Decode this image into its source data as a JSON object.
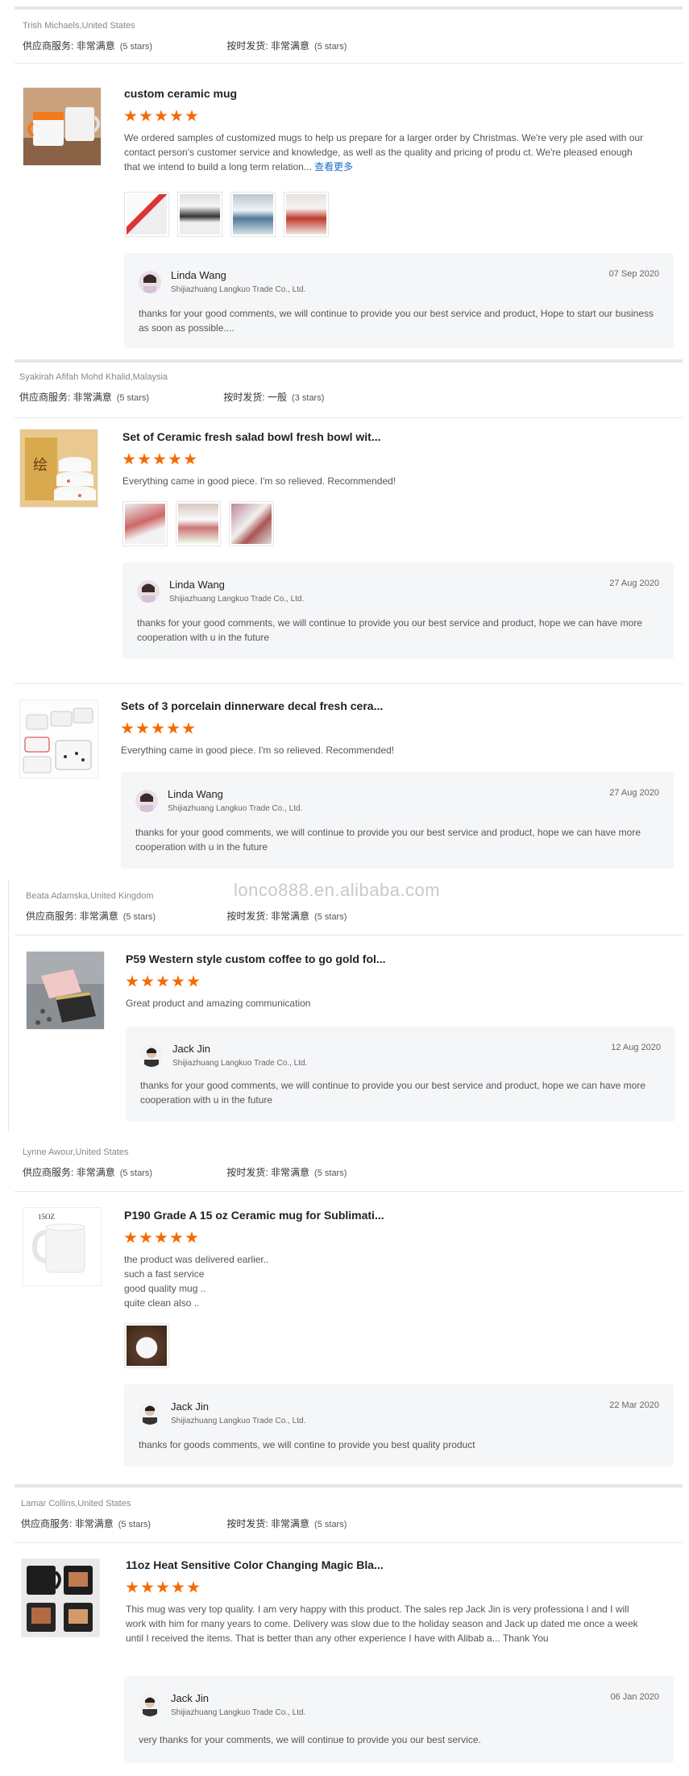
{
  "watermark": "lonco888.en.alibaba.com",
  "labels": {
    "supplier_service": "供应商服务:",
    "on_time": "按时发货:"
  },
  "reviews": [
    {
      "reviewer": "Trish Michaels,United States",
      "supplier_value": "非常满意",
      "supplier_stars": "(5 stars)",
      "ontime_value": "非常满意",
      "ontime_stars": "(5 stars)",
      "items": [
        {
          "title": "custom ceramic mug",
          "rating": 5,
          "text": "We ordered samples of customized mugs to help us prepare for a larger order by Christmas.  We're very ple ased with our contact person's customer service and knowledge, as well as the quality and pricing of produ ct. We're pleased enough that we intend to build a long term relation...",
          "more": "查看更多",
          "reply": {
            "name": "Linda Wang",
            "company": "Shijiazhuang Langkuo Trade Co., Ltd.",
            "date": "07 Sep 2020",
            "text": "thanks for your good comments, we will continue to provide you our best service and product, Hope to start our business as soon as possible...."
          }
        }
      ]
    },
    {
      "reviewer": "Syakirah Afifah Mohd Khalid,Malaysia",
      "supplier_value": "非常满意",
      "supplier_stars": "(5 stars)",
      "ontime_value": "一般",
      "ontime_stars": "(3 stars)",
      "items": [
        {
          "title": "Set of Ceramic fresh salad bowl fresh bowl wit...",
          "rating": 5,
          "text": "Everything came in good piece. I'm so relieved. Recommended!",
          "reply": {
            "name": "Linda Wang",
            "company": "Shijiazhuang Langkuo Trade Co., Ltd.",
            "date": "27 Aug 2020",
            "text": "thanks for your good comments, we will continue to provide you our best service and product, hope we can have more cooperation with u in the future"
          }
        },
        {
          "title": "Sets of 3 porcelain dinnerware decal fresh cera...",
          "rating": 5,
          "text": "Everything came in good piece. I'm so relieved. Recommended!",
          "reply": {
            "name": "Linda Wang",
            "company": "Shijiazhuang Langkuo Trade Co., Ltd.",
            "date": "27 Aug 2020",
            "text": "thanks for your good comments, we will continue to provide you our best service and product, hope we can have more cooperation with u in the future"
          }
        }
      ]
    },
    {
      "reviewer": "Beata Adamska,United Kingdom",
      "supplier_value": "非常满意",
      "supplier_stars": "(5 stars)",
      "ontime_value": "非常满意",
      "ontime_stars": "(5 stars)",
      "items": [
        {
          "title": "P59 Western style custom coffee to go gold fol...",
          "rating": 5,
          "text": "Great product and amazing communication",
          "reply": {
            "name": "Jack Jin",
            "company": "Shijiazhuang Langkuo Trade Co., Ltd.",
            "date": "12 Aug 2020",
            "text": "thanks for your good comments, we will continue to provide you our best service and product, hope we can have more cooperation with u in the future"
          }
        }
      ]
    },
    {
      "reviewer": "Lynne Awour,United States",
      "supplier_value": "非常满意",
      "supplier_stars": "(5 stars)",
      "ontime_value": "非常满意",
      "ontime_stars": "(5 stars)",
      "items": [
        {
          "title": "P190 Grade A 15 oz Ceramic mug for Sublimati...",
          "thumb_label": "15OZ",
          "rating": 5,
          "text_lines": [
            "the product was delivered earlier..",
            "such a fast service",
            "good quality mug ..",
            "quite clean also .."
          ],
          "reply": {
            "name": "Jack Jin",
            "company": "Shijiazhuang Langkuo Trade Co., Ltd.",
            "date": "22 Mar 2020",
            "text": "thanks for goods comments, we will contine to provide you best quality product"
          }
        }
      ]
    },
    {
      "reviewer": "Lamar Collins,United States",
      "supplier_value": "非常满意",
      "supplier_stars": "(5 stars)",
      "ontime_value": "非常满意",
      "ontime_stars": "(5 stars)",
      "items": [
        {
          "title": "11oz Heat Sensitive Color Changing Magic Bla...",
          "rating": 5,
          "text": "This mug was very top quality. I am very happy with this product. The sales rep Jack Jin is very professiona l and I will work with him for many years to come. Delivery was slow due to the holiday season and Jack up dated me once a week until I received the items. That is better than any other experience I have with Alibab a... Thank You",
          "reply": {
            "name": "Jack Jin",
            "company": "Shijiazhuang Langkuo Trade Co., Ltd.",
            "date": "06 Jan 2020",
            "text": "very thanks for your comments, we will continue to provide you our best service."
          }
        }
      ]
    }
  ]
}
